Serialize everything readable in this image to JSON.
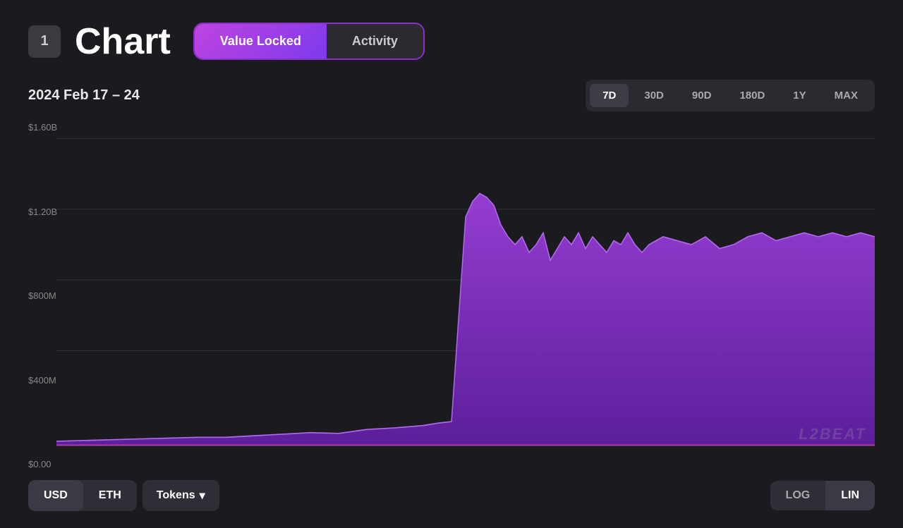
{
  "header": {
    "badge": "1",
    "title": "Chart",
    "tabs": [
      {
        "id": "value-locked",
        "label": "Value Locked",
        "active": true
      },
      {
        "id": "activity",
        "label": "Activity",
        "active": false
      }
    ]
  },
  "controls": {
    "date_range": "2024 Feb 17 – 24",
    "time_buttons": [
      {
        "id": "7d",
        "label": "7D",
        "active": true
      },
      {
        "id": "30d",
        "label": "30D",
        "active": false
      },
      {
        "id": "90d",
        "label": "90D",
        "active": false
      },
      {
        "id": "180d",
        "label": "180D",
        "active": false
      },
      {
        "id": "1y",
        "label": "1Y",
        "active": false
      },
      {
        "id": "max",
        "label": "MAX",
        "active": false
      }
    ]
  },
  "y_axis": {
    "labels": [
      "$1.60B",
      "$1.20B",
      "$800M",
      "$400M",
      "$0.00"
    ]
  },
  "chart": {
    "watermark": "L2BEAT",
    "accent_color": "#7c3aed",
    "fill_color": "rgba(140,60,220,0.85)"
  },
  "bottom": {
    "currency_buttons": [
      {
        "id": "usd",
        "label": "USD",
        "active": true
      },
      {
        "id": "eth",
        "label": "ETH",
        "active": false
      }
    ],
    "tokens_label": "Tokens",
    "tokens_icon": "▾",
    "scale_buttons": [
      {
        "id": "log",
        "label": "LOG",
        "active": false
      },
      {
        "id": "lin",
        "label": "LIN",
        "active": true
      }
    ]
  }
}
